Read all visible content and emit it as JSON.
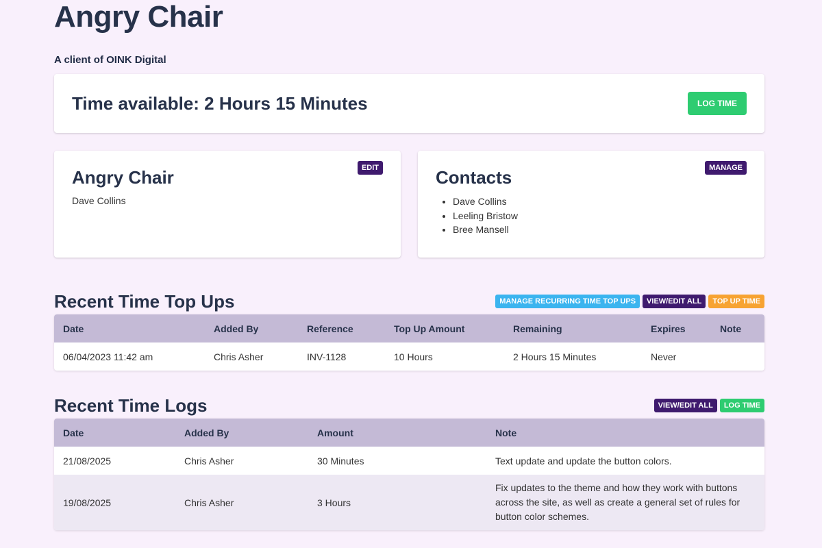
{
  "page": {
    "title": "Angry Chair",
    "subtitle": "A client of OINK Digital"
  },
  "time_card": {
    "heading": "Time available: 2 Hours 15 Minutes",
    "log_time_label": "Log Time"
  },
  "client_card": {
    "name": "Angry Chair",
    "edit_label": "Edit",
    "contact": "Dave Collins"
  },
  "contacts_card": {
    "heading": "Contacts",
    "manage_label": "Manage",
    "items": [
      "Dave Collins",
      "Leeling Bristow",
      "Bree Mansell"
    ]
  },
  "top_ups": {
    "heading": "Recent Time Top Ups",
    "manage_recurring_label": "Manage Recurring Time Top Ups",
    "view_edit_label": "View/Edit All",
    "top_up_label": "Top Up Time",
    "columns": [
      "Date",
      "Added By",
      "Reference",
      "Top Up Amount",
      "Remaining",
      "Expires",
      "Note"
    ],
    "rows": [
      [
        "06/04/2023 11:42 am",
        "Chris Asher",
        "INV-1128",
        "10 Hours",
        "2 Hours 15 Minutes",
        "Never",
        ""
      ]
    ]
  },
  "time_logs": {
    "heading": "Recent Time Logs",
    "view_edit_label": "View/Edit All",
    "log_time_label": "Log Time",
    "columns": [
      "Date",
      "Added By",
      "Amount",
      "Note"
    ],
    "rows": [
      [
        "21/08/2025",
        "Chris Asher",
        "30 Minutes",
        "Text update and update the button colors."
      ],
      [
        "19/08/2025",
        "Chris Asher",
        "3 Hours",
        "Fix updates to the theme and how they work with buttons across the site, as well as create a general set of rules for button color schemes."
      ]
    ]
  },
  "colors": {
    "background": "#f9f0fc",
    "green": "#2ecc71",
    "purple": "#3f1a6e",
    "blue": "#3bb4ef",
    "orange": "#f7a332",
    "table_header": "#c4bad6"
  }
}
